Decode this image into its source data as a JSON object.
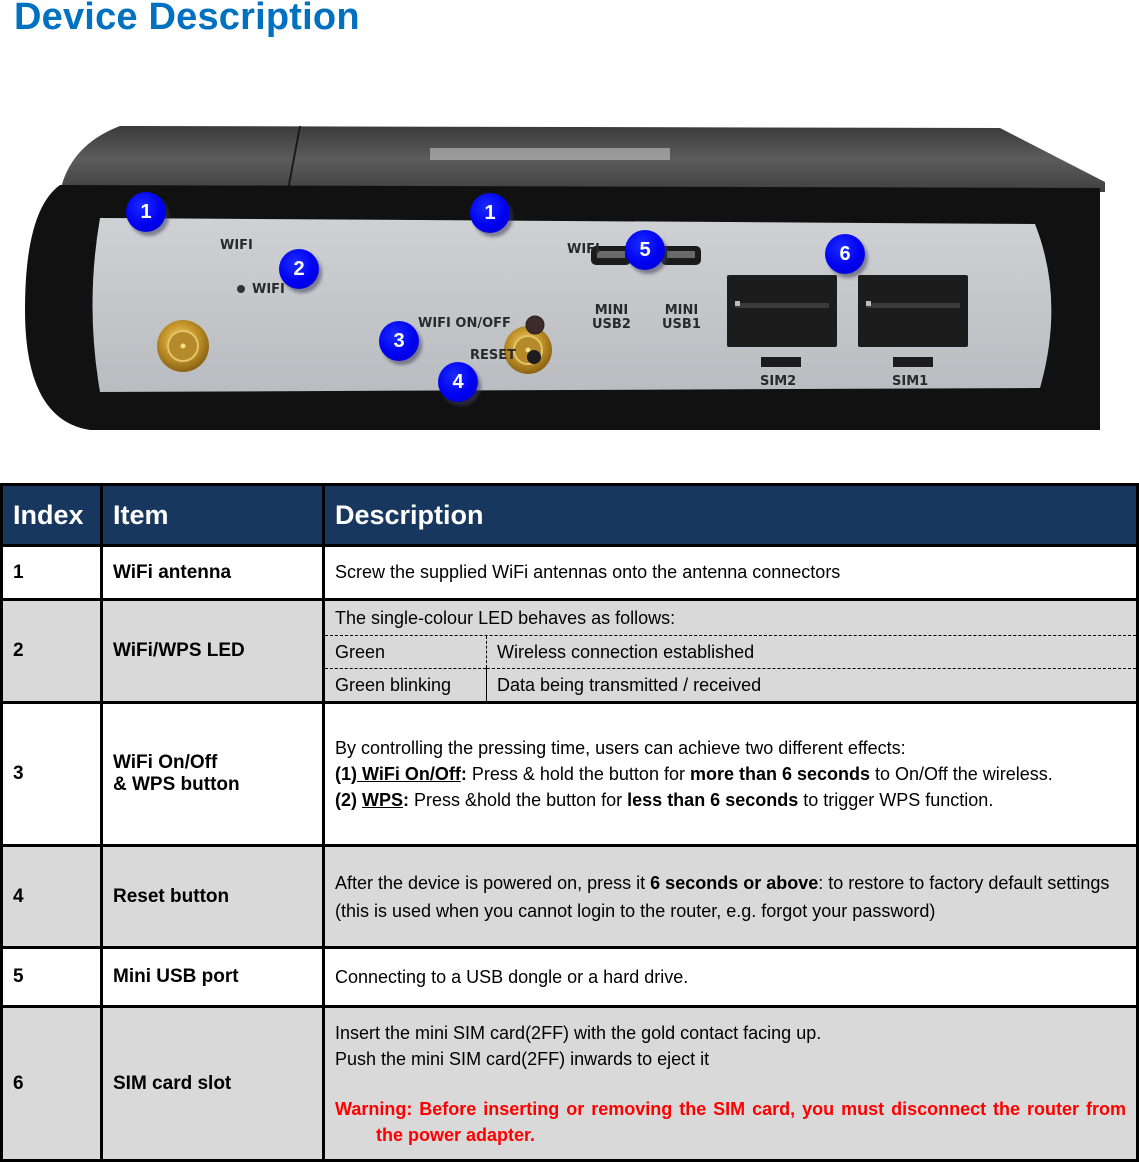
{
  "page": {
    "title": "Device Description"
  },
  "device_image": {
    "panel_labels": {
      "wifi_antenna_left": "WIFI",
      "wifi_led": "WIFI",
      "wifi_antenna_right": "WIFI",
      "wifi_onoff": "WIFI ON/OFF",
      "reset": "RESET",
      "mini_usb2": "MINI\nUSB2",
      "mini_usb1": "MINI\nUSB1",
      "sim2": "SIM2",
      "sim1": "SIM1"
    },
    "callouts": [
      {
        "number": "1",
        "target": "wifi-antenna-left"
      },
      {
        "number": "1",
        "target": "wifi-antenna-right"
      },
      {
        "number": "2",
        "target": "wifi-led"
      },
      {
        "number": "3",
        "target": "wifi-onoff-button"
      },
      {
        "number": "4",
        "target": "reset-button"
      },
      {
        "number": "5",
        "target": "mini-usb-ports"
      },
      {
        "number": "6",
        "target": "sim-slots"
      }
    ],
    "callout_color": "#0000f0"
  },
  "table": {
    "headers": {
      "index": "Index",
      "item": "Item",
      "description": "Description"
    },
    "header_bg": "#17375e",
    "rows": [
      {
        "index": "1",
        "item": "WiFi antenna",
        "description": "Screw the supplied WiFi antennas onto the antenna connectors"
      },
      {
        "index": "2",
        "item": "WiFi/WPS LED",
        "intro": "The single-colour LED behaves as follows:",
        "led_states": [
          {
            "state": "Green",
            "meaning": "Wireless connection established"
          },
          {
            "state": "Green blinking",
            "meaning": "Data being transmitted / received"
          }
        ]
      },
      {
        "index": "3",
        "item_line1": "WiFi On/Off",
        "item_line2": "& WPS button",
        "intro": "By controlling the pressing time, users can achieve two different effects:",
        "effect1": {
          "prefix": "(1)",
          "name": " WiFi On/Off",
          "colon": ":",
          "text_a": " Press & hold the button for ",
          "bold": "more than 6 seconds",
          "text_b": " to On/Off the wireless."
        },
        "effect2": {
          "prefix": "(2) ",
          "name": "WPS",
          "colon": ":",
          "text_a": " Press &hold the button for ",
          "bold": "less than 6 seconds",
          "text_b": " to trigger WPS function."
        }
      },
      {
        "index": "4",
        "item": "Reset button",
        "text_a": "After the device is powered on, press it ",
        "bold": "6 seconds or above",
        "text_b": ": to restore to factory default settings (this is used when you cannot login to the router, e.g. forgot your password)"
      },
      {
        "index": "5",
        "item": "Mini USB port",
        "description": "Connecting to a USB dongle or a hard drive."
      },
      {
        "index": "6",
        "item": "SIM card slot",
        "line1": "Insert the mini SIM card(2FF) with the gold contact facing up.",
        "line2": "Push the mini SIM card(2FF)  inwards to eject it",
        "warning": "Warning: Before inserting or removing the SIM card, you must disconnect the router from the power adapter.",
        "warning_color": "#ff0000"
      }
    ]
  }
}
